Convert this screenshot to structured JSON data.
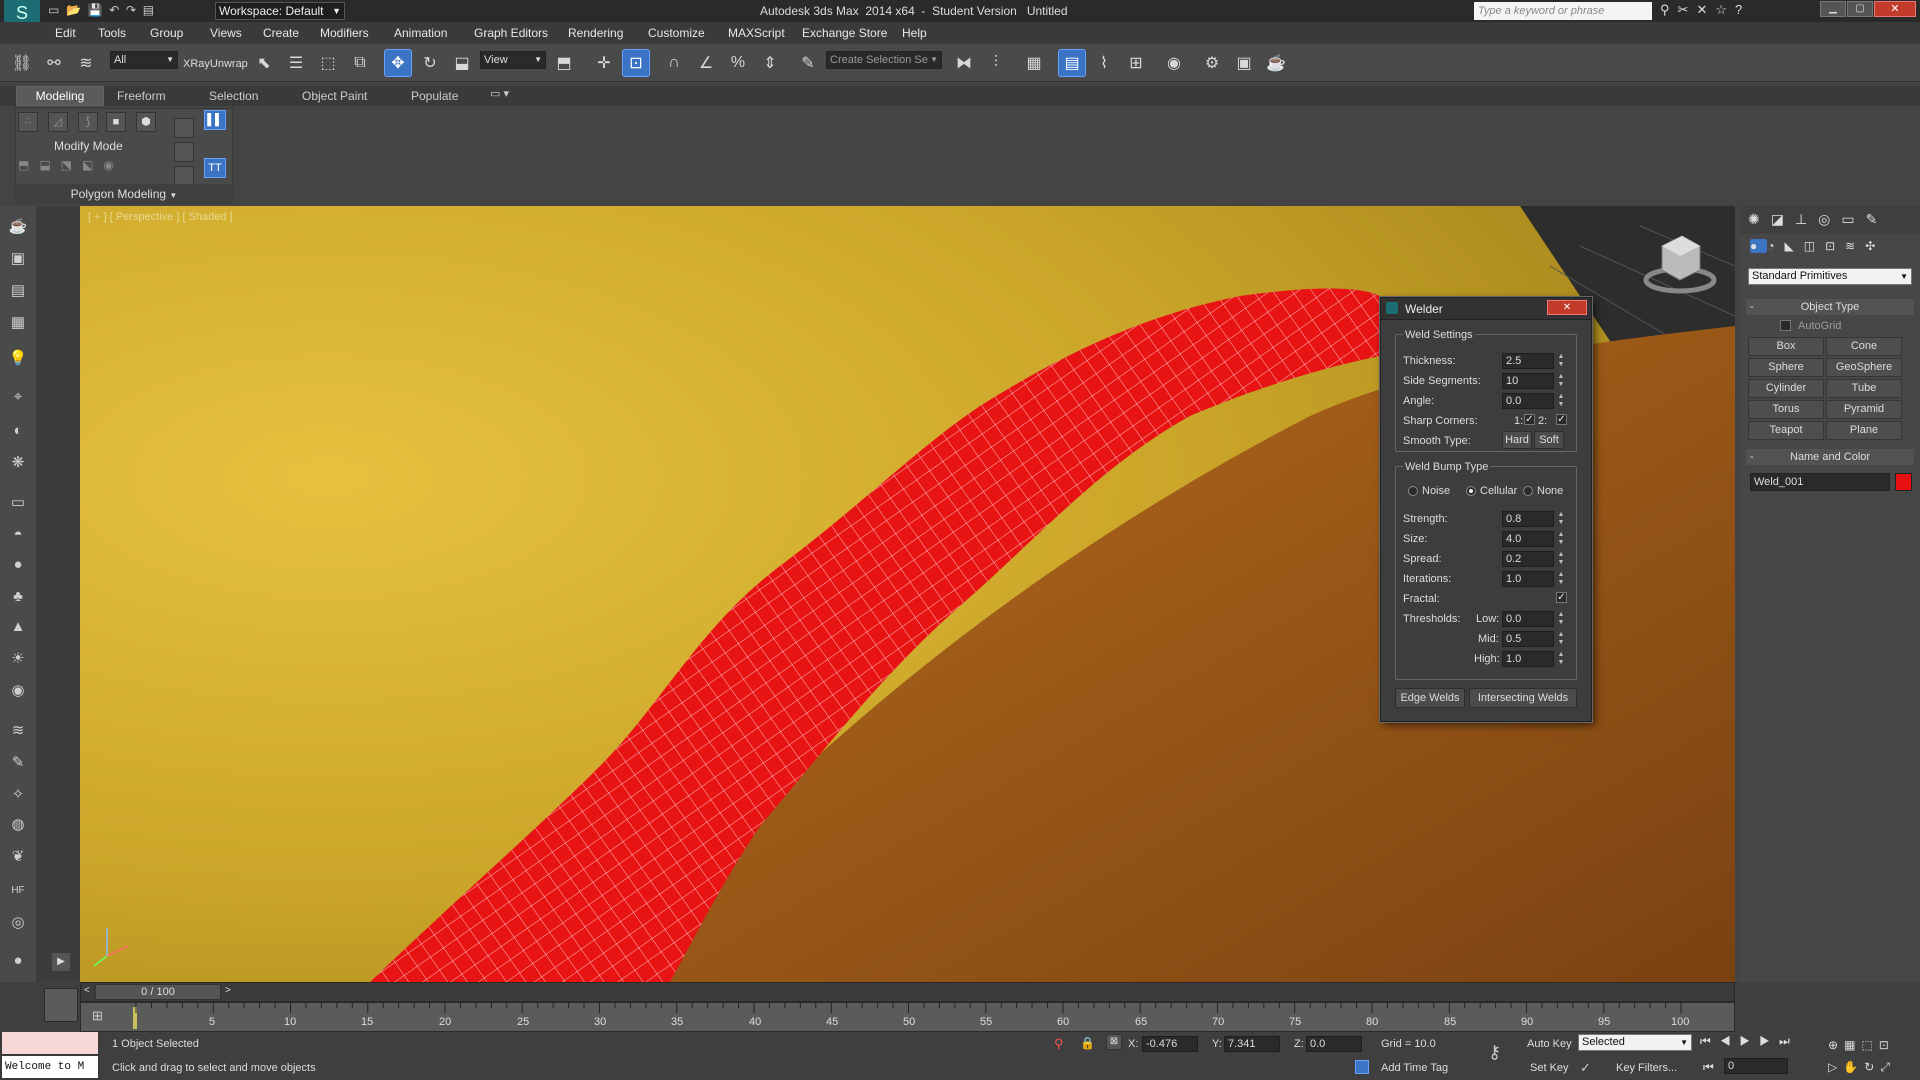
{
  "titlebar": {
    "workspace": "Workspace: Default",
    "title": "Autodesk 3ds Max  2014 x64  -  Student Version   Untitled",
    "search_placeholder": "Type a keyword or phrase"
  },
  "menu": [
    "Edit",
    "Tools",
    "Group",
    "Views",
    "Create",
    "Modifiers",
    "Animation",
    "Graph Editors",
    "Rendering",
    "Customize",
    "MAXScript",
    "Exchange Store",
    "Help"
  ],
  "toolbar": {
    "filter": "All",
    "xray_label": "XRayUnwrap",
    "ref_coord": "View",
    "selection_set_placeholder": "Create Selection Se"
  },
  "ribbon": {
    "tabs": [
      "Modeling",
      "Freeform",
      "Selection",
      "Object Paint",
      "Populate"
    ],
    "active_tab": "Modeling",
    "modify_mode": "Modify Mode",
    "polygon_modeling": "Polygon Modeling"
  },
  "viewport": {
    "label": "[ + ] [ Perspective ] [ Shaded ]"
  },
  "welder": {
    "title": "Welder",
    "weld_settings": "Weld Settings",
    "thickness_label": "Thickness:",
    "thickness": "2.5",
    "side_segments_label": "Side Segments:",
    "side_segments": "10",
    "angle_label": "Angle:",
    "angle": "0.0",
    "sharp_corners_label": "Sharp Corners:",
    "sc1": "1:",
    "sc2": "2:",
    "smooth_type_label": "Smooth Type:",
    "hard": "Hard",
    "soft": "Soft",
    "bump_type": "Weld Bump Type",
    "noise": "Noise",
    "cellular": "Cellular",
    "none": "None",
    "strength_label": "Strength:",
    "strength": "0.8",
    "size_label": "Size:",
    "size": "4.0",
    "spread_label": "Spread:",
    "spread": "0.2",
    "iterations_label": "Iterations:",
    "iterations": "1.0",
    "fractal_label": "Fractal:",
    "thresholds_label": "Thresholds:",
    "low_label": "Low:",
    "low": "0.0",
    "mid_label": "Mid:",
    "mid": "0.5",
    "high_label": "High:",
    "high": "1.0",
    "edge_welds": "Edge Welds",
    "intersecting_welds": "Intersecting Welds"
  },
  "command_panel": {
    "dropdown": "Standard Primitives",
    "object_type": "Object Type",
    "autogrid": "AutoGrid",
    "buttons": [
      "Box",
      "Cone",
      "Sphere",
      "GeoSphere",
      "Cylinder",
      "Tube",
      "Torus",
      "Pyramid",
      "Teapot",
      "Plane"
    ],
    "name_and_color": "Name and Color",
    "object_name": "Weld_001",
    "object_color": "#e81010"
  },
  "timeline": {
    "frame": "0 / 100",
    "ticks": [
      "5",
      "10",
      "15",
      "20",
      "25",
      "30",
      "35",
      "40",
      "45",
      "50",
      "55",
      "60",
      "65",
      "70",
      "75",
      "80",
      "85",
      "90",
      "95",
      "100"
    ]
  },
  "status": {
    "welcome": "Welcome to M",
    "selected": "1 Object Selected",
    "prompt": "Click and drag to select and move objects",
    "x_label": "X:",
    "x": "-0.476",
    "y_label": "Y:",
    "y": "7.341",
    "z_label": "Z:",
    "z": "0.0",
    "grid": "Grid = 10.0",
    "add_time_tag": "Add Time Tag",
    "auto_key": "Auto Key",
    "set_key": "Set Key",
    "key_mode": "Selected",
    "key_filters": "Key Filters...",
    "current_frame": "0"
  }
}
